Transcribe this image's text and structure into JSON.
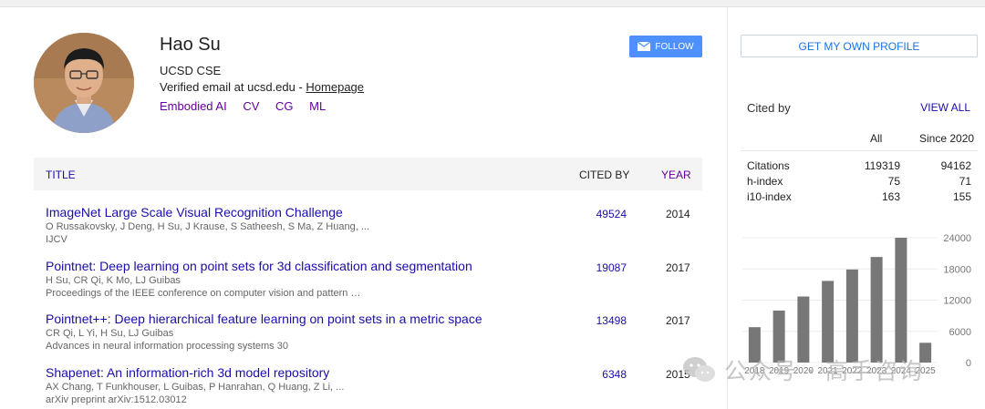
{
  "profile": {
    "name": "Hao Su",
    "affiliation": "UCSD CSE",
    "email_text": "Verified email at ucsd.edu - ",
    "homepage_label": "Homepage",
    "interests": [
      "Embodied AI",
      "CV",
      "CG",
      "ML"
    ],
    "follow_label": "FOLLOW"
  },
  "table": {
    "headers": {
      "title": "TITLE",
      "cited_by": "CITED BY",
      "year": "YEAR"
    },
    "rows": [
      {
        "title": "ImageNet Large Scale Visual Recognition Challenge",
        "authors": "O Russakovsky, J Deng, H Su, J Krause, S Satheesh, S Ma, Z Huang, ...",
        "venue": "IJCV",
        "cited": "49524",
        "year": "2014"
      },
      {
        "title": "Pointnet: Deep learning on point sets for 3d classification and segmentation",
        "authors": "H Su, CR Qi, K Mo, LJ Guibas",
        "venue": "Proceedings of the IEEE conference on computer vision and pattern …",
        "cited": "19087",
        "year": "2017"
      },
      {
        "title": "Pointnet++: Deep hierarchical feature learning on point sets in a metric space",
        "authors": "CR Qi, L Yi, H Su, LJ Guibas",
        "venue": "Advances in neural information processing systems 30",
        "cited": "13498",
        "year": "2017"
      },
      {
        "title": "Shapenet: An information-rich 3d model repository",
        "authors": "AX Chang, T Funkhouser, L Guibas, P Hanrahan, Q Huang, Z Li, ...",
        "venue": "arXiv preprint arXiv:1512.03012",
        "cited": "6348",
        "year": "2015"
      }
    ]
  },
  "sidebar": {
    "get_profile_label": "GET MY OWN PROFILE",
    "cited_by_label": "Cited by",
    "view_all_label": "VIEW ALL",
    "col_all": "All",
    "col_since": "Since 2020",
    "stats": [
      {
        "label": "Citations",
        "all": "119319",
        "since": "94162"
      },
      {
        "label": "h-index",
        "all": "75",
        "since": "71"
      },
      {
        "label": "i10-index",
        "all": "163",
        "since": "155"
      }
    ]
  },
  "chart_data": {
    "type": "bar",
    "categories": [
      "2018",
      "2019",
      "2020",
      "2021",
      "2022",
      "2023",
      "2024",
      "2025"
    ],
    "values": [
      6800,
      10000,
      12700,
      15700,
      17900,
      20300,
      24000,
      3800
    ],
    "ylim": [
      0,
      24000
    ],
    "yticks": [
      "24000",
      "18000",
      "12000",
      "6000",
      "0"
    ],
    "bar_color": "#777777",
    "grid": true
  },
  "watermark": {
    "text": "公众号 · 高手咨询"
  },
  "colors": {
    "link": "#1a0dab",
    "visited": "#660099",
    "button": "#4d90fe"
  }
}
